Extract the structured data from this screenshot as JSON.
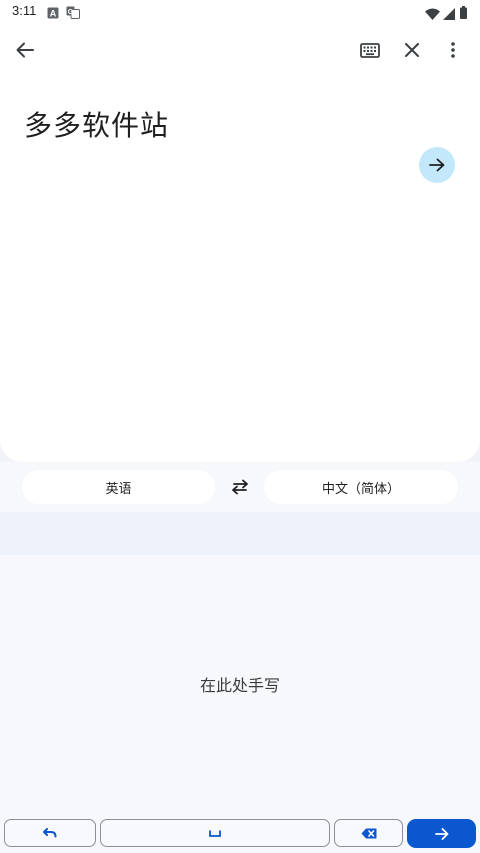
{
  "status_bar": {
    "time": "3:11",
    "left_icons": [
      "keyboard-a-icon",
      "translate-icon"
    ],
    "right_icons": [
      "wifi-icon",
      "signal-icon",
      "battery-icon"
    ]
  },
  "toolbar": {
    "back_icon": "arrow-back-icon",
    "keyboard_icon": "keyboard-icon",
    "close_icon": "close-icon",
    "more_icon": "more-vert-icon"
  },
  "input": {
    "text": "多多软件站",
    "go_icon": "arrow-forward-icon"
  },
  "languages": {
    "source": "英语",
    "target": "中文（简体）",
    "swap_icon": "swap-icon"
  },
  "handwriting": {
    "hint": "在此处手写"
  },
  "keyboard_bar": {
    "undo_icon": "undo-icon",
    "space_icon": "space-icon",
    "backspace_icon": "backspace-icon",
    "enter_icon": "arrow-forward-icon"
  },
  "colors": {
    "accent": "#0b57d0",
    "go_button_bg": "#c3e7fb",
    "card_bg": "#ffffff",
    "background": "#f1f3f8"
  }
}
